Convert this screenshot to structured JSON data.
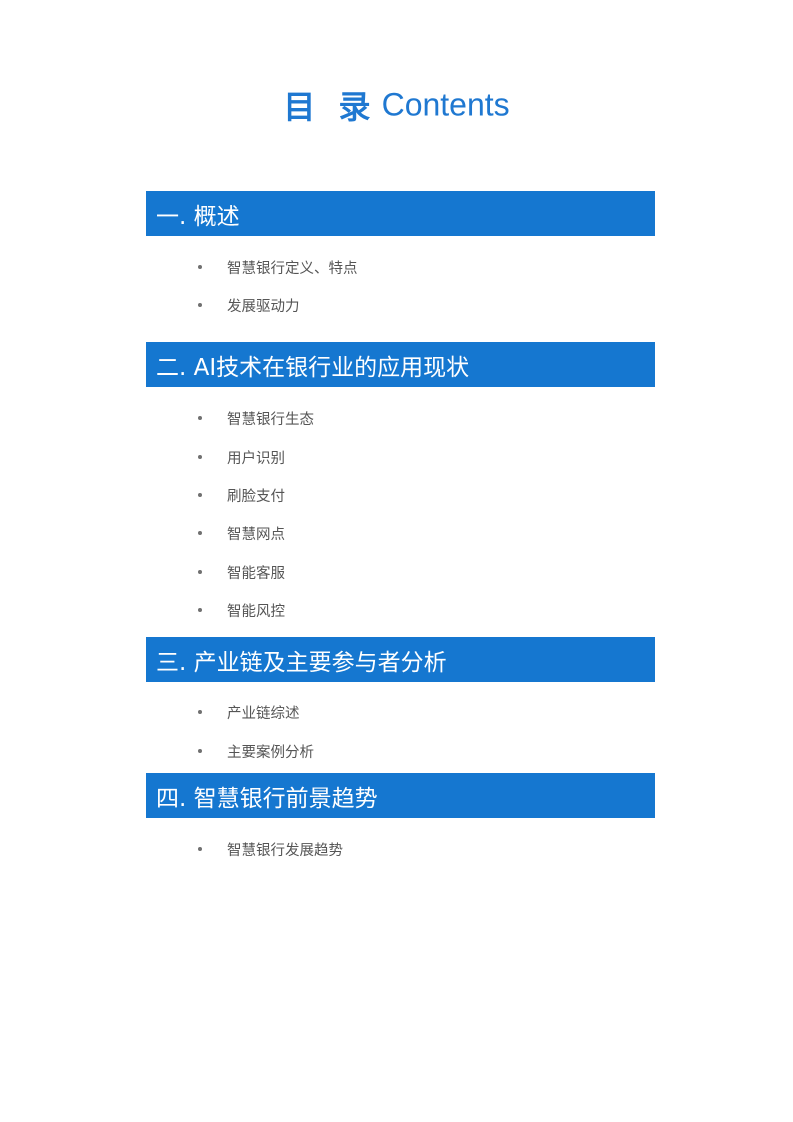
{
  "page_title": {
    "cn": "目 录",
    "en": "Contents"
  },
  "sections": [
    {
      "title": "一. 概述",
      "items": [
        "智慧银行定义、特点",
        "发展驱动力"
      ]
    },
    {
      "title": "二. AI技术在银行业的应用现状",
      "items": [
        "智慧银行生态",
        "用户识别",
        "刷脸支付",
        "智慧网点",
        "智能客服",
        "智能风控"
      ]
    },
    {
      "title": "三. 产业链及主要参与者分析",
      "items": [
        "产业链综述",
        "主要案例分析"
      ]
    },
    {
      "title": "四. 智慧银行前景趋势",
      "items": [
        "智慧银行发展趋势"
      ]
    }
  ],
  "colors": {
    "accent": "#1577d0",
    "title_text": "#1f78d1",
    "bullet_text": "#555555"
  }
}
